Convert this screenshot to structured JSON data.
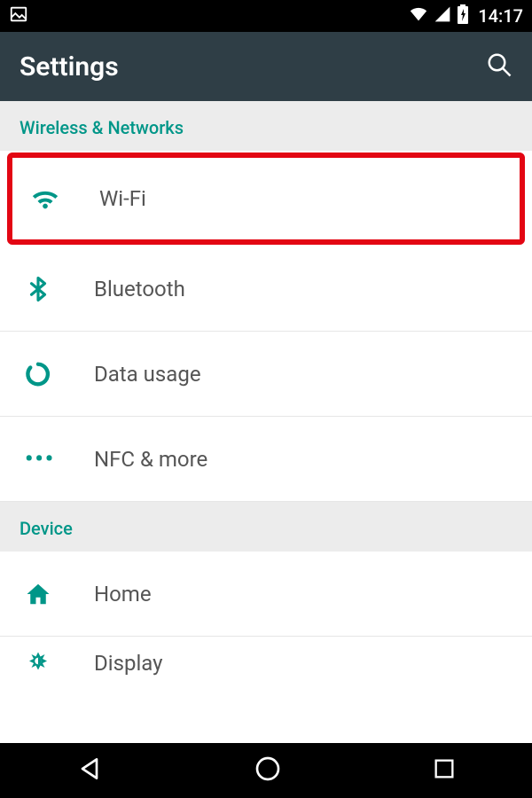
{
  "status_bar": {
    "time": "14:17"
  },
  "header": {
    "title": "Settings"
  },
  "sections": {
    "wireless": {
      "title": "Wireless & Networks",
      "items": {
        "wifi": "Wi-Fi",
        "bluetooth": "Bluetooth",
        "data_usage": "Data usage",
        "nfc_more": "NFC & more"
      }
    },
    "device": {
      "title": "Device",
      "items": {
        "home": "Home",
        "display": "Display"
      }
    }
  },
  "colors": {
    "accent": "#009688",
    "highlight": "#e30613",
    "header_bg": "#2f3e46"
  }
}
